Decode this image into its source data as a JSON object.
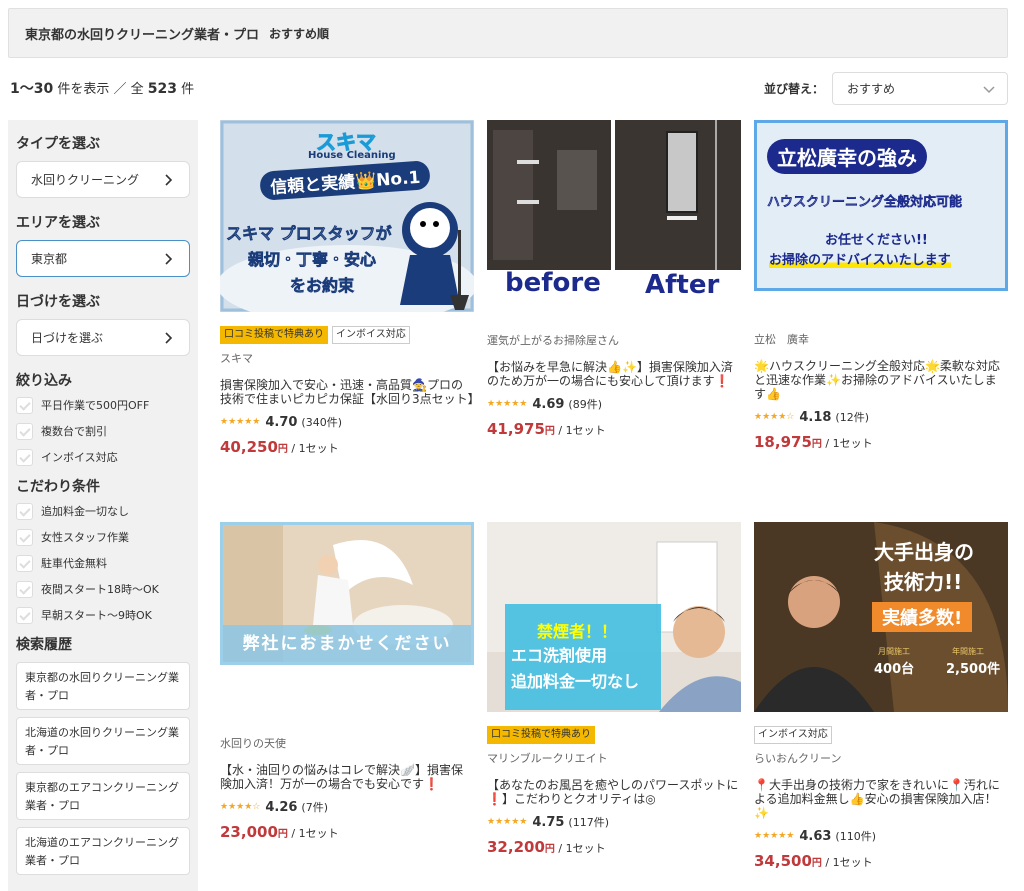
{
  "header": {
    "title": "東京都の水回りクリーニング業者・プロ",
    "sort_note": "おすすめ順"
  },
  "results": {
    "range": "1〜30",
    "range_suffix": "件を表示 ／ 全",
    "total": "523",
    "total_suffix": "件"
  },
  "sort": {
    "label": "並び替え：",
    "value": "おすすめ"
  },
  "sidebar": {
    "type_heading": "タイプを選ぶ",
    "type_value": "水回りクリーニング",
    "area_heading": "エリアを選ぶ",
    "area_value": "東京都",
    "date_heading": "日づけを選ぶ",
    "date_value": "日づけを選ぶ",
    "filter_heading": "絞り込み",
    "filters": [
      "平日作業で500円OFF",
      "複数台で割引",
      "インボイス対応"
    ],
    "pref_heading": "こだわり条件",
    "prefs": [
      "追加料金一切なし",
      "女性スタッフ作業",
      "駐車代金無料",
      "夜間スタート18時〜OK",
      "早朝スタート〜9時OK"
    ],
    "history_heading": "検索履歴",
    "history": [
      "東京都の水回りクリーニング業者・プロ",
      "北海道の水回りクリーニング業者・プロ",
      "東京都のエアコンクリーニング業者・プロ",
      "北海道のエアコンクリーニング業者・プロ"
    ]
  },
  "cards": [
    {
      "badges": [
        "口コミ投稿で特典あり",
        "インボイス対応"
      ],
      "shop": "スキマ",
      "desc": "損害保険加入で安心・迅速・高品質🧙プロの技術で住まいピカピカ保証【水回り3点セット】",
      "stars": "★★★★★",
      "rating": "4.70",
      "reviews": "(340件)",
      "price": "40,250",
      "yen": "円",
      "unit": "/ 1セット",
      "img": {
        "brand": "スキマ",
        "sub": "House Cleaning",
        "l1": "信頼と実績👑No.1",
        "l2": "スキマ プロスタッフが",
        "l3": "親切・丁寧・安心",
        "l4": "をお約束"
      }
    },
    {
      "badges": [],
      "shop": "運気が上がるお掃除屋さん",
      "desc": "【お悩みを早急に解決👍✨】損害保険加入済のため万が一の場合にも安心して頂けます❗",
      "stars": "★★★★★",
      "rating": "4.69",
      "reviews": "(89件)",
      "price": "41,975",
      "yen": "円",
      "unit": "/ 1セット",
      "img": {
        "before": "before",
        "after": "After"
      }
    },
    {
      "badges": [],
      "shop": "立松　廣幸",
      "desc": "🌟ハウスクリーニング全般対応🌟柔軟な対応と迅速な作業✨お掃除のアドバイスいたします👍",
      "stars": "★★★★☆",
      "rating": "4.18",
      "reviews": "(12件)",
      "price": "18,975",
      "yen": "円",
      "unit": "/ 1セット",
      "img": {
        "l1": "立松廣幸の強み",
        "l2": "ハウスクリーニング全般対応可能",
        "l3": "お任せください!!",
        "l4": "お掃除のアドバイスいたします"
      }
    },
    {
      "badges": [],
      "shop": "水回りの天使",
      "desc": "【水・油回りの悩みはコレで解決🪽】損害保険加入済！万が一の場合でも安心です❗",
      "stars": "★★★★☆",
      "rating": "4.26",
      "reviews": "(7件)",
      "price": "23,000",
      "yen": "円",
      "unit": "/ 1セット",
      "img": {
        "l1": "弊社におまかせください"
      }
    },
    {
      "badges": [
        "口コミ投稿で特典あり"
      ],
      "shop": "マリンブルークリエイト",
      "desc": "【あなたのお風呂を癒やしのパワースポットに❗】こだわりとクオリティは◎",
      "stars": "★★★★★",
      "rating": "4.75",
      "reviews": "(117件)",
      "price": "32,200",
      "yen": "円",
      "unit": "/ 1セット",
      "img": {
        "l1": "禁煙者！！",
        "l2": "エコ洗剤使用",
        "l3": "追加料金一切なし"
      }
    },
    {
      "badges": [
        "インボイス対応"
      ],
      "shop": "らいおんクリーン",
      "desc": "📍大手出身の技術力で家をきれいに📍汚れによる追加料金無し👍安心の損害保険加入店！✨",
      "stars": "★★★★★",
      "rating": "4.63",
      "reviews": "(110件)",
      "price": "34,500",
      "yen": "円",
      "unit": "/ 1セット",
      "img": {
        "l1": "大手出身の",
        "l2": "技術力!!",
        "l3": "実績多数!",
        "m1": "月間施工",
        "m1v": "400台",
        "m2": "年間施工",
        "m2v": "2,500件"
      }
    }
  ]
}
